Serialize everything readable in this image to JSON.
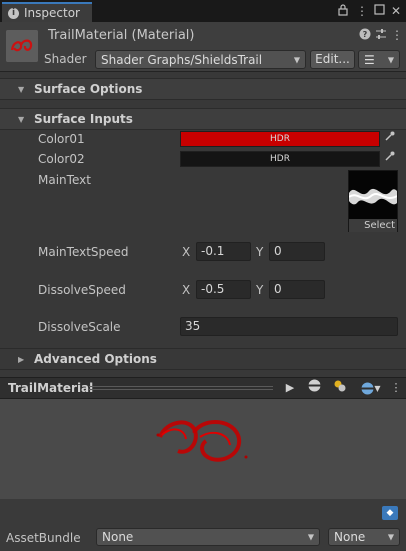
{
  "window": {
    "tab_label": "Inspector",
    "tab_icons": [
      "lock-icon",
      "menu-icon",
      "maximize-icon",
      "close-icon"
    ]
  },
  "header": {
    "title": "TrailMaterial (Material)",
    "shader_label": "Shader",
    "shader_value": "Shader Graphs/ShieldsTrail",
    "edit_label": "Edit...",
    "icons": [
      "help-icon",
      "settings-sliders-icon",
      "more-icon"
    ]
  },
  "sections": {
    "surface_options": "Surface Options",
    "surface_inputs": "Surface Inputs",
    "advanced_options": "Advanced Options"
  },
  "properties": {
    "color01": {
      "label": "Color01",
      "badge": "HDR",
      "color": "#c80000"
    },
    "color02": {
      "label": "Color02",
      "badge": "HDR",
      "color": "#141414"
    },
    "main_text": {
      "label": "MainText",
      "select_label": "Select"
    },
    "main_text_speed": {
      "label": "MainTextSpeed",
      "x_label": "X",
      "x": "-0.1",
      "y_label": "Y",
      "y": "0"
    },
    "dissolve_speed": {
      "label": "DissolveSpeed",
      "x_label": "X",
      "x": "-0.5",
      "y_label": "Y",
      "y": "0"
    },
    "dissolve_scale": {
      "label": "DissolveScale",
      "value": "35"
    }
  },
  "preview": {
    "title": "TrailMaterial"
  },
  "asset_bundle": {
    "label": "AssetBundle",
    "name_value": "None",
    "variant_value": "None"
  },
  "colors": {
    "accent": "#3a79bb",
    "panel": "#383838",
    "material_red": "#d20000"
  }
}
